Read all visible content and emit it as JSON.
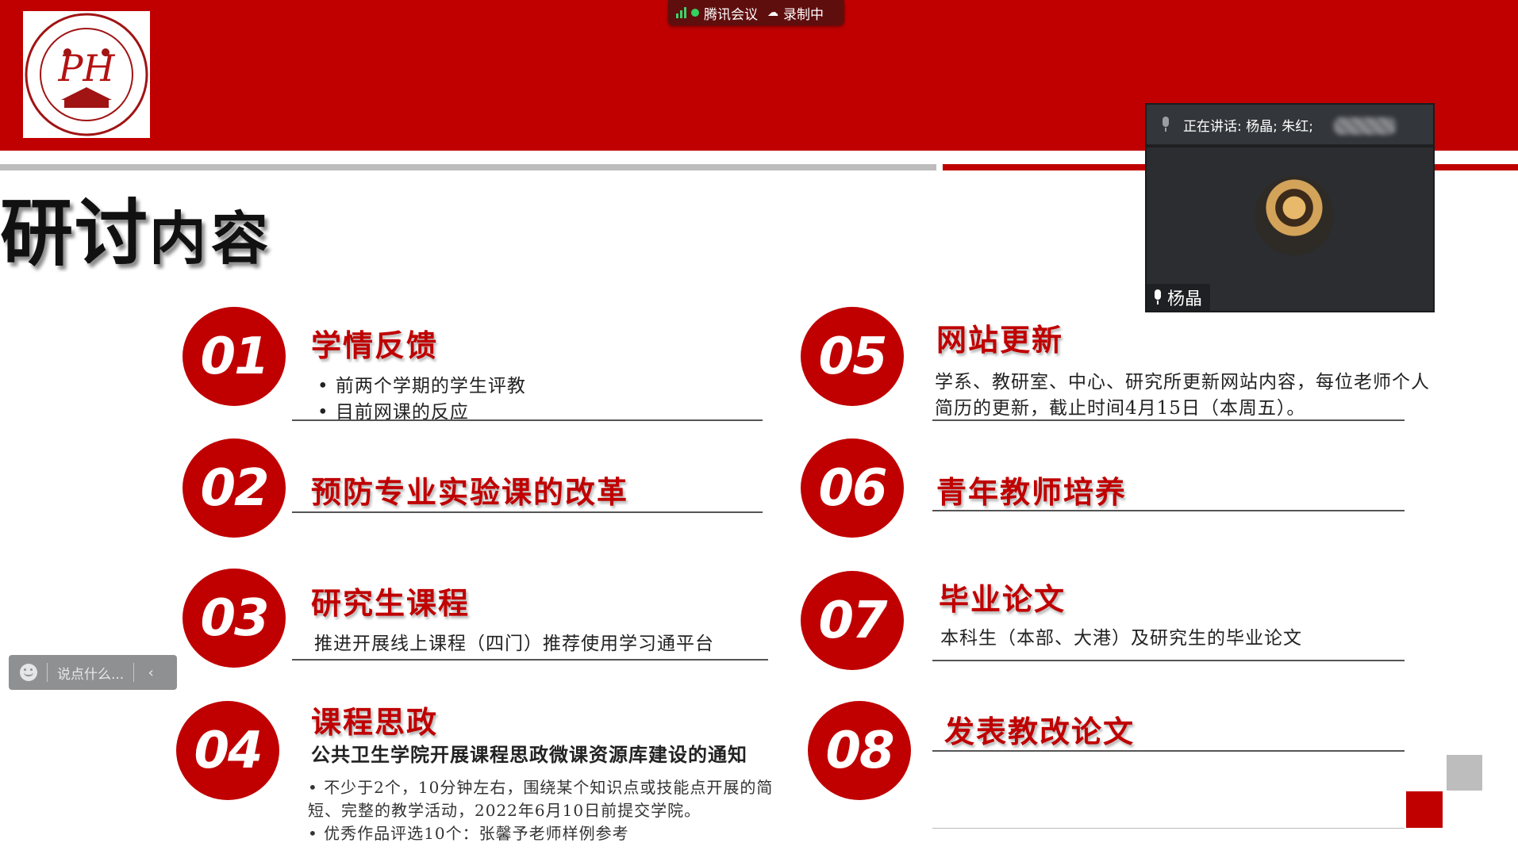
{
  "colors": {
    "brand_red": "#c00000",
    "gray_rule": "#bdbdbd"
  },
  "meeting": {
    "app_name": "腾讯会议",
    "recording": "录制中"
  },
  "page_title": {
    "part1": "研讨",
    "part2": "内容"
  },
  "items": [
    {
      "num": "01",
      "title": "学情反馈",
      "lines": [
        "• 前两个学期的学生评教",
        "• 目前网课的反应"
      ]
    },
    {
      "num": "02",
      "title": "预防专业实验课的改革"
    },
    {
      "num": "03",
      "title": "研究生课程",
      "lines": [
        "推进开展线上课程（四门）推荐使用学习通平台"
      ]
    },
    {
      "num": "04",
      "title": "课程思政",
      "lines": [
        "公共卫生学院开展课程思政微课资源库建设的通知",
        "•   不少于2个，10分钟左右，围绕某个知识点或技能点开展的简",
        "    短、完整的教学活动，2022年6月10日前提交学院。",
        "•   优秀作品评选10个：张馨予老师样例参考"
      ]
    },
    {
      "num": "05",
      "title": "网站更新",
      "lines": [
        "学系、教研室、中心、研究所更新网站内容，每位老师个人",
        "简历的更新，截止时间4月15日（本周五）。"
      ]
    },
    {
      "num": "06",
      "title": "青年教师培养"
    },
    {
      "num": "07",
      "title": "毕业论文",
      "lines": [
        "本科生（本部、大港）及研究生的毕业论文"
      ]
    },
    {
      "num": "08",
      "title": "发表教改论文"
    }
  ],
  "video": {
    "speaking_label": "正在讲话: 杨晶; 朱红;",
    "participant_name": "杨晶"
  },
  "chat": {
    "placeholder": "说点什么..."
  },
  "icons": [
    "signal-icon",
    "cloud-icon",
    "mic-icon",
    "smile-icon",
    "chevron-left-icon",
    "school-logo"
  ]
}
